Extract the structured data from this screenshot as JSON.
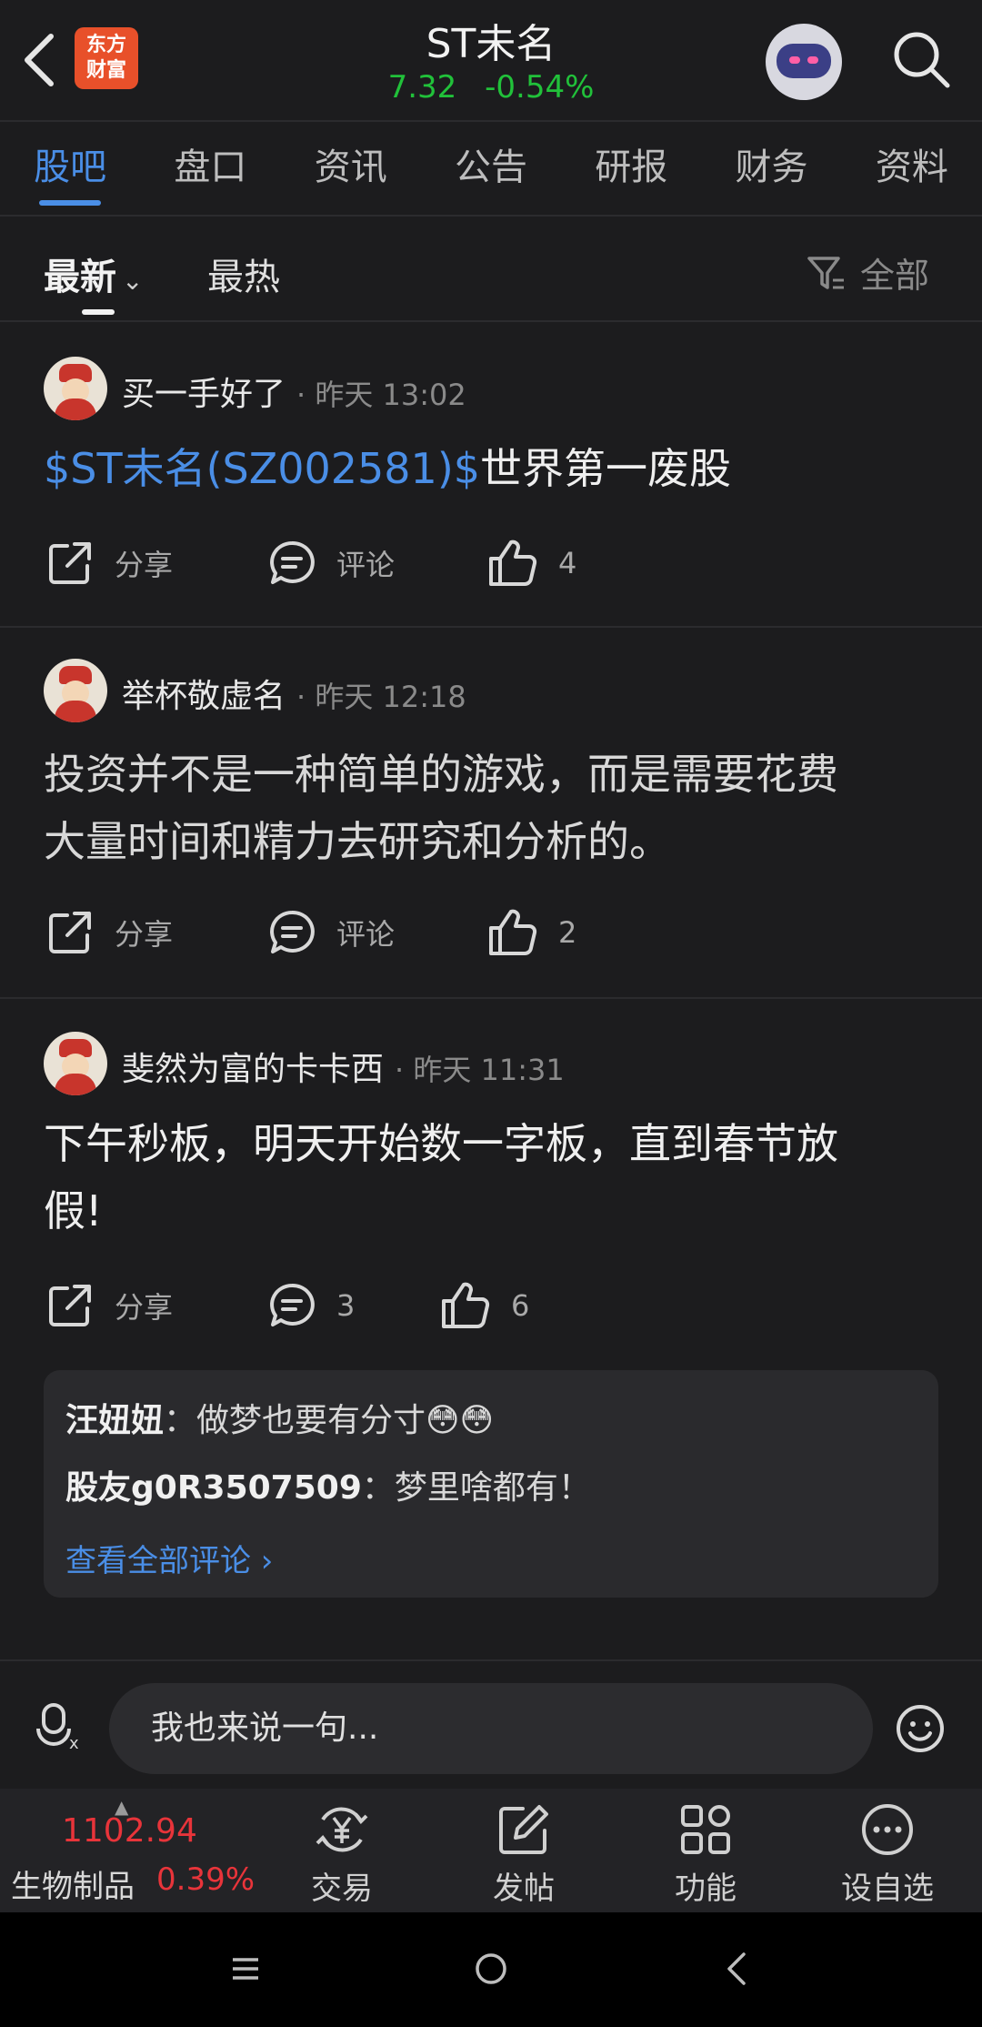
{
  "header": {
    "title": "ST未名",
    "price": "7.32",
    "change": "-0.54%",
    "logo_text_line1": "东方",
    "logo_text_line2": "财富"
  },
  "tabs": [
    "股吧",
    "盘口",
    "资讯",
    "公告",
    "研报",
    "财务",
    "资料"
  ],
  "sort": {
    "latest": "最新",
    "hot": "最热",
    "filter": "全部"
  },
  "posts": [
    {
      "author": "买一手好了",
      "time": "· 昨天 13:02",
      "content_link": "$ST未名(SZ002581)$",
      "content": "世界第一废股",
      "share": "分享",
      "comment": "评论",
      "likes": "4"
    },
    {
      "author": "举杯敬虚名",
      "time": "· 昨天 12:18",
      "content_line1": "投资并不是一种简单的游戏，而是需要花费",
      "content_line2": "大量时间和精力去研究和分析的。",
      "share": "分享",
      "comment": "评论",
      "likes": "2"
    },
    {
      "author": "斐然为富的卡卡西",
      "time": "· 昨天 11:31",
      "content_line1": "下午秒板，明天开始数一字板，直到春节放",
      "content_line2": "假!",
      "share": "分享",
      "comment": "3",
      "likes": "6",
      "replies": [
        {
          "user": "汪妞妞",
          "text": "：做梦也要有分寸😳😳"
        },
        {
          "user": "股友g0R3507509",
          "text": "：梦里啥都有！"
        }
      ],
      "more": "查看全部评论 ›"
    }
  ],
  "input": {
    "placeholder": "我也来说一句..."
  },
  "bottom": {
    "index_value": "1102.94",
    "index_name": "生物制品",
    "index_pct": "0.39%",
    "items": [
      "交易",
      "发帖",
      "功能",
      "设自选"
    ]
  },
  "colors": {
    "accent": "#4a8ee6",
    "up": "#e8343a",
    "down": "#21c13a",
    "background": "#1c1c1e"
  }
}
